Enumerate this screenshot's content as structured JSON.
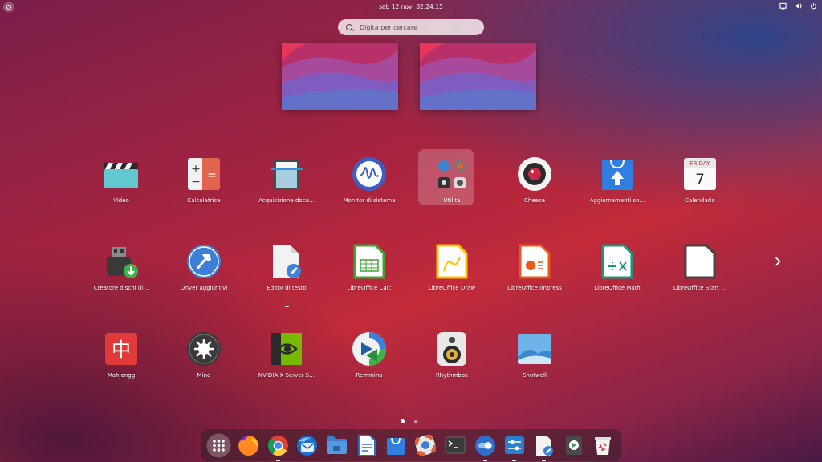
{
  "topbar": {
    "clock": "sab 12 nov  02:24:15"
  },
  "search": {
    "placeholder": "Digita per cercare"
  },
  "apps": [
    {
      "label": "Video",
      "icon": "video-icon"
    },
    {
      "label": "Calcolatrice",
      "icon": "calculator-icon"
    },
    {
      "label": "Acquisizione docu…",
      "icon": "scanner-icon"
    },
    {
      "label": "Monitor di sistema",
      "icon": "system-monitor-icon"
    },
    {
      "label": "Utilità",
      "icon": "folder-icon"
    },
    {
      "label": "Cheese",
      "icon": "cheese-icon"
    },
    {
      "label": "Aggiornamenti so…",
      "icon": "software-updater-icon"
    },
    {
      "label": "Calendario",
      "icon": "calendar-icon",
      "day": "FRIDAY",
      "date": "7"
    },
    {
      "label": "Creatore dischi di…",
      "icon": "usb-creator-icon"
    },
    {
      "label": "Driver aggiuntivi",
      "icon": "driver-icon"
    },
    {
      "label": "Editor di testo",
      "icon": "text-editor-icon"
    },
    {
      "label": "LibreOffice Calc",
      "icon": "libreoffice-calc-icon",
      "color": "#3fa535"
    },
    {
      "label": "LibreOffice Draw",
      "icon": "libreoffice-draw-icon",
      "color": "#ffc000"
    },
    {
      "label": "LibreOffice Impress",
      "icon": "libreoffice-impress-icon",
      "color": "#e8591a"
    },
    {
      "label": "LibreOffice Math",
      "icon": "libreoffice-math-icon",
      "color": "#19977a"
    },
    {
      "label": "LibreOffice Start …",
      "icon": "libreoffice-start-icon",
      "color": "#444444"
    },
    {
      "label": "Mahjongg",
      "icon": "mahjongg-icon",
      "glyph": "中"
    },
    {
      "label": "Mine",
      "icon": "mines-icon"
    },
    {
      "label": "NVIDIA X Server S…",
      "icon": "nvidia-icon"
    },
    {
      "label": "Remmina",
      "icon": "remmina-icon"
    },
    {
      "label": "Rhythmbox",
      "icon": "rhythmbox-icon"
    },
    {
      "label": "Shotwell",
      "icon": "shotwell-icon"
    }
  ],
  "dock": [
    {
      "icon": "app-grid-icon"
    },
    {
      "icon": "firefox-icon"
    },
    {
      "icon": "chrome-icon"
    },
    {
      "icon": "thunderbird-icon"
    },
    {
      "icon": "files-icon"
    },
    {
      "icon": "libreoffice-writer-icon"
    },
    {
      "icon": "software-store-icon"
    },
    {
      "icon": "help-icon"
    },
    {
      "icon": "terminal-icon"
    },
    {
      "icon": "toggle-icon"
    },
    {
      "icon": "settings-icon"
    },
    {
      "icon": "text-editor-icon"
    },
    {
      "icon": "disk-usage-icon"
    },
    {
      "icon": "trash-icon"
    }
  ]
}
